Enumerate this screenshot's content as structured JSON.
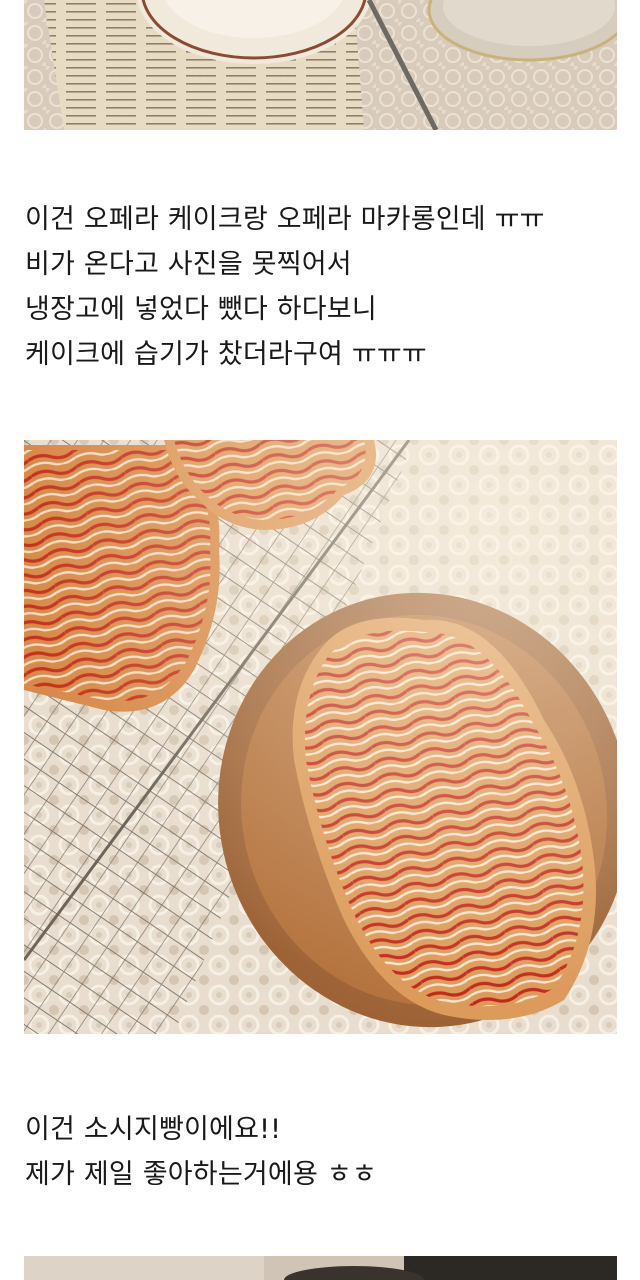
{
  "caption_1": {
    "lines": [
      "이건 오페라 케이크랑 오페라 마카롱인데 ㅠㅠ",
      "비가 온다고 사진을 못찍어서",
      "냉장고에 넣었다 뺐다 하다보니",
      "케이크에 습기가 찼더라구여 ㅠㅠㅠ"
    ]
  },
  "caption_2": {
    "lines": [
      "이건 소시지빵이에요!!",
      "제가 제일 좋아하는거에용 ㅎㅎ"
    ]
  },
  "images": [
    {
      "name": "photo-plate-book-lace"
    },
    {
      "name": "photo-sausage-bread"
    },
    {
      "name": "photo-next-partial"
    }
  ]
}
